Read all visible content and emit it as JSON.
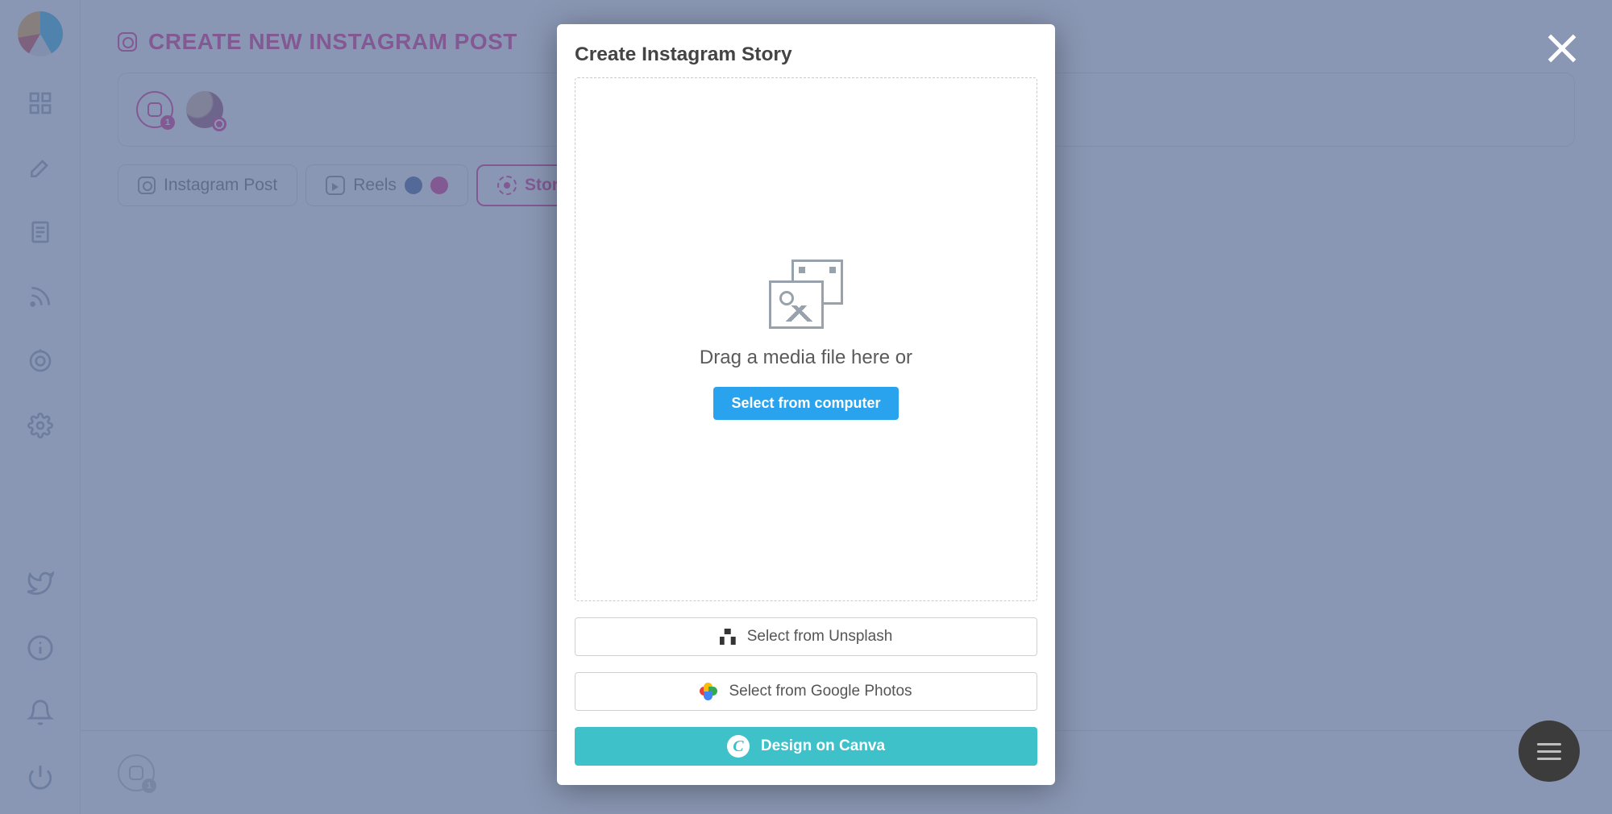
{
  "header": {
    "title": "CREATE NEW INSTAGRAM POST"
  },
  "accounts": {
    "badge_count": "1"
  },
  "tabs": {
    "instagram_post": "Instagram Post",
    "reels": "Reels",
    "story_post": "Story Post"
  },
  "footer": {
    "badge": "1"
  },
  "modal": {
    "title": "Create Instagram Story",
    "drag_text": "Drag a media file here or",
    "select_computer": "Select from computer",
    "unsplash": "Select from Unsplash",
    "google_photos": "Select from Google Photos",
    "canva": "Design on Canva",
    "canva_glyph": "C"
  },
  "sidebar": {
    "items": [
      "dashboard",
      "compose",
      "content",
      "rss",
      "analytics",
      "settings"
    ],
    "bottom": [
      "twitter",
      "info",
      "notifications",
      "power"
    ]
  }
}
